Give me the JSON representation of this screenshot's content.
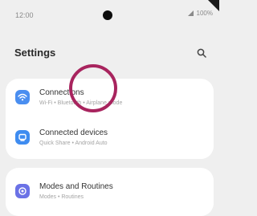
{
  "status_bar": {
    "time": "12:00",
    "battery": "100%"
  },
  "header": {
    "title": "Settings",
    "search_icon": "search-icon"
  },
  "settings": [
    {
      "title": "Connections",
      "subtitle": "Wi-Fi • Bluetooth • Airplane mode",
      "icon": "wifi-icon",
      "color": "#4a8ef0"
    },
    {
      "title": "Connected devices",
      "subtitle": "Quick Share • Android Auto",
      "icon": "devices-icon",
      "color": "#3e8cf0"
    },
    {
      "title": "Modes and Routines",
      "subtitle": "Modes • Routines",
      "icon": "modes-icon",
      "color": "#6b72e6"
    }
  ],
  "touch_indicator_color": "#a8245e"
}
